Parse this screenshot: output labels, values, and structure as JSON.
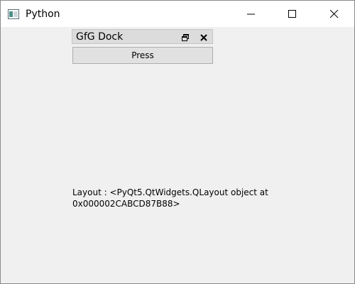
{
  "window": {
    "title": "Python",
    "icon": "python-window-icon",
    "controls": [
      "minimize-icon",
      "maximize-icon",
      "close-icon"
    ]
  },
  "dock": {
    "title": "GfG Dock",
    "float_icon": "float-dock-icon",
    "close_icon": "close-dock-icon",
    "button_label": "Press"
  },
  "label": {
    "text": "Layout : <PyQt5.QtWidgets.QLayout object at\n0x000002CABCD87B88>"
  }
}
